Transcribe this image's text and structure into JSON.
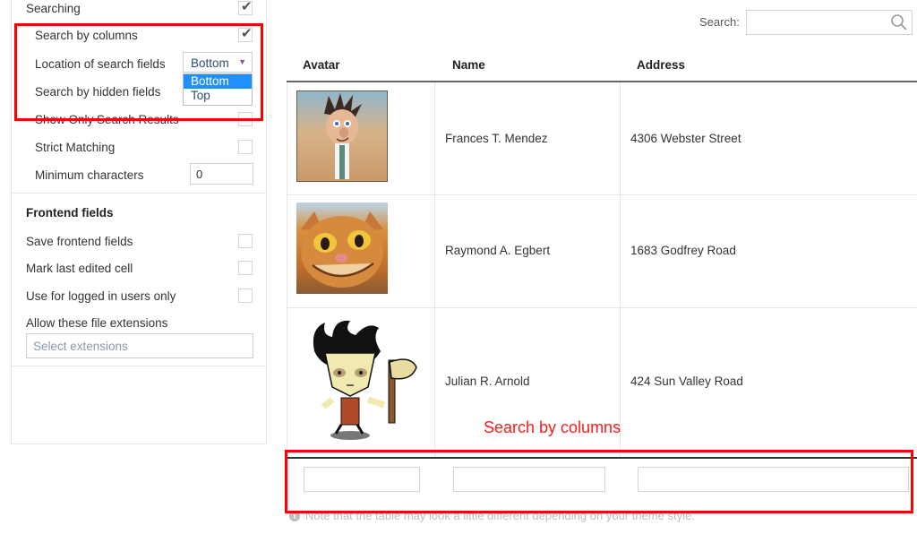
{
  "settings_panel": {
    "searching": {
      "label": "Searching",
      "checked": true
    },
    "search_by_columns": {
      "label": "Search by columns",
      "checked": true
    },
    "location_of_search_fields": {
      "label": "Location of search fields",
      "selected": "Bottom",
      "options": [
        "Bottom",
        "Top"
      ],
      "dropdown_open": true
    },
    "search_by_hidden_fields": {
      "label": "Search by hidden fields"
    },
    "show_only_search_results": {
      "label": "Show Only Search Results",
      "checked": false
    },
    "strict_matching": {
      "label": "Strict Matching",
      "checked": false
    },
    "minimum_characters": {
      "label": "Minimum characters",
      "value": "0"
    },
    "frontend_section": {
      "title": "Frontend fields",
      "save_frontend_fields": {
        "label": "Save frontend fields",
        "checked": false
      },
      "mark_last_edited_cell": {
        "label": "Mark last edited cell",
        "checked": false
      },
      "logged_in_only": {
        "label": "Use for logged in users only",
        "checked": false
      },
      "file_extensions": {
        "label": "Allow these file extensions",
        "placeholder": "Select extensions"
      }
    },
    "checkmark_glyph": "✔"
  },
  "table": {
    "search_label": "Search:",
    "search_value": "",
    "columns": [
      "Avatar",
      "Name",
      "Address"
    ],
    "rows": [
      {
        "avatar": "cartoon-scientist-avatar",
        "name": "Frances T. Mendez",
        "address": "4306 Webster Street"
      },
      {
        "avatar": "cartoon-cat-avatar",
        "name": "Raymond A. Egbert",
        "address": "1683 Godfrey Road"
      },
      {
        "avatar": "cartoon-axe-man-avatar",
        "name": "Julian R. Arnold",
        "address": "424 Sun Valley Road"
      }
    ],
    "column_search_inputs": [
      "",
      "",
      ""
    ],
    "note": "Note that the table may look a little different depending on your theme style.",
    "note_icon": "i"
  },
  "annotations": {
    "label": "Search by columns",
    "color": "#ff0000"
  }
}
